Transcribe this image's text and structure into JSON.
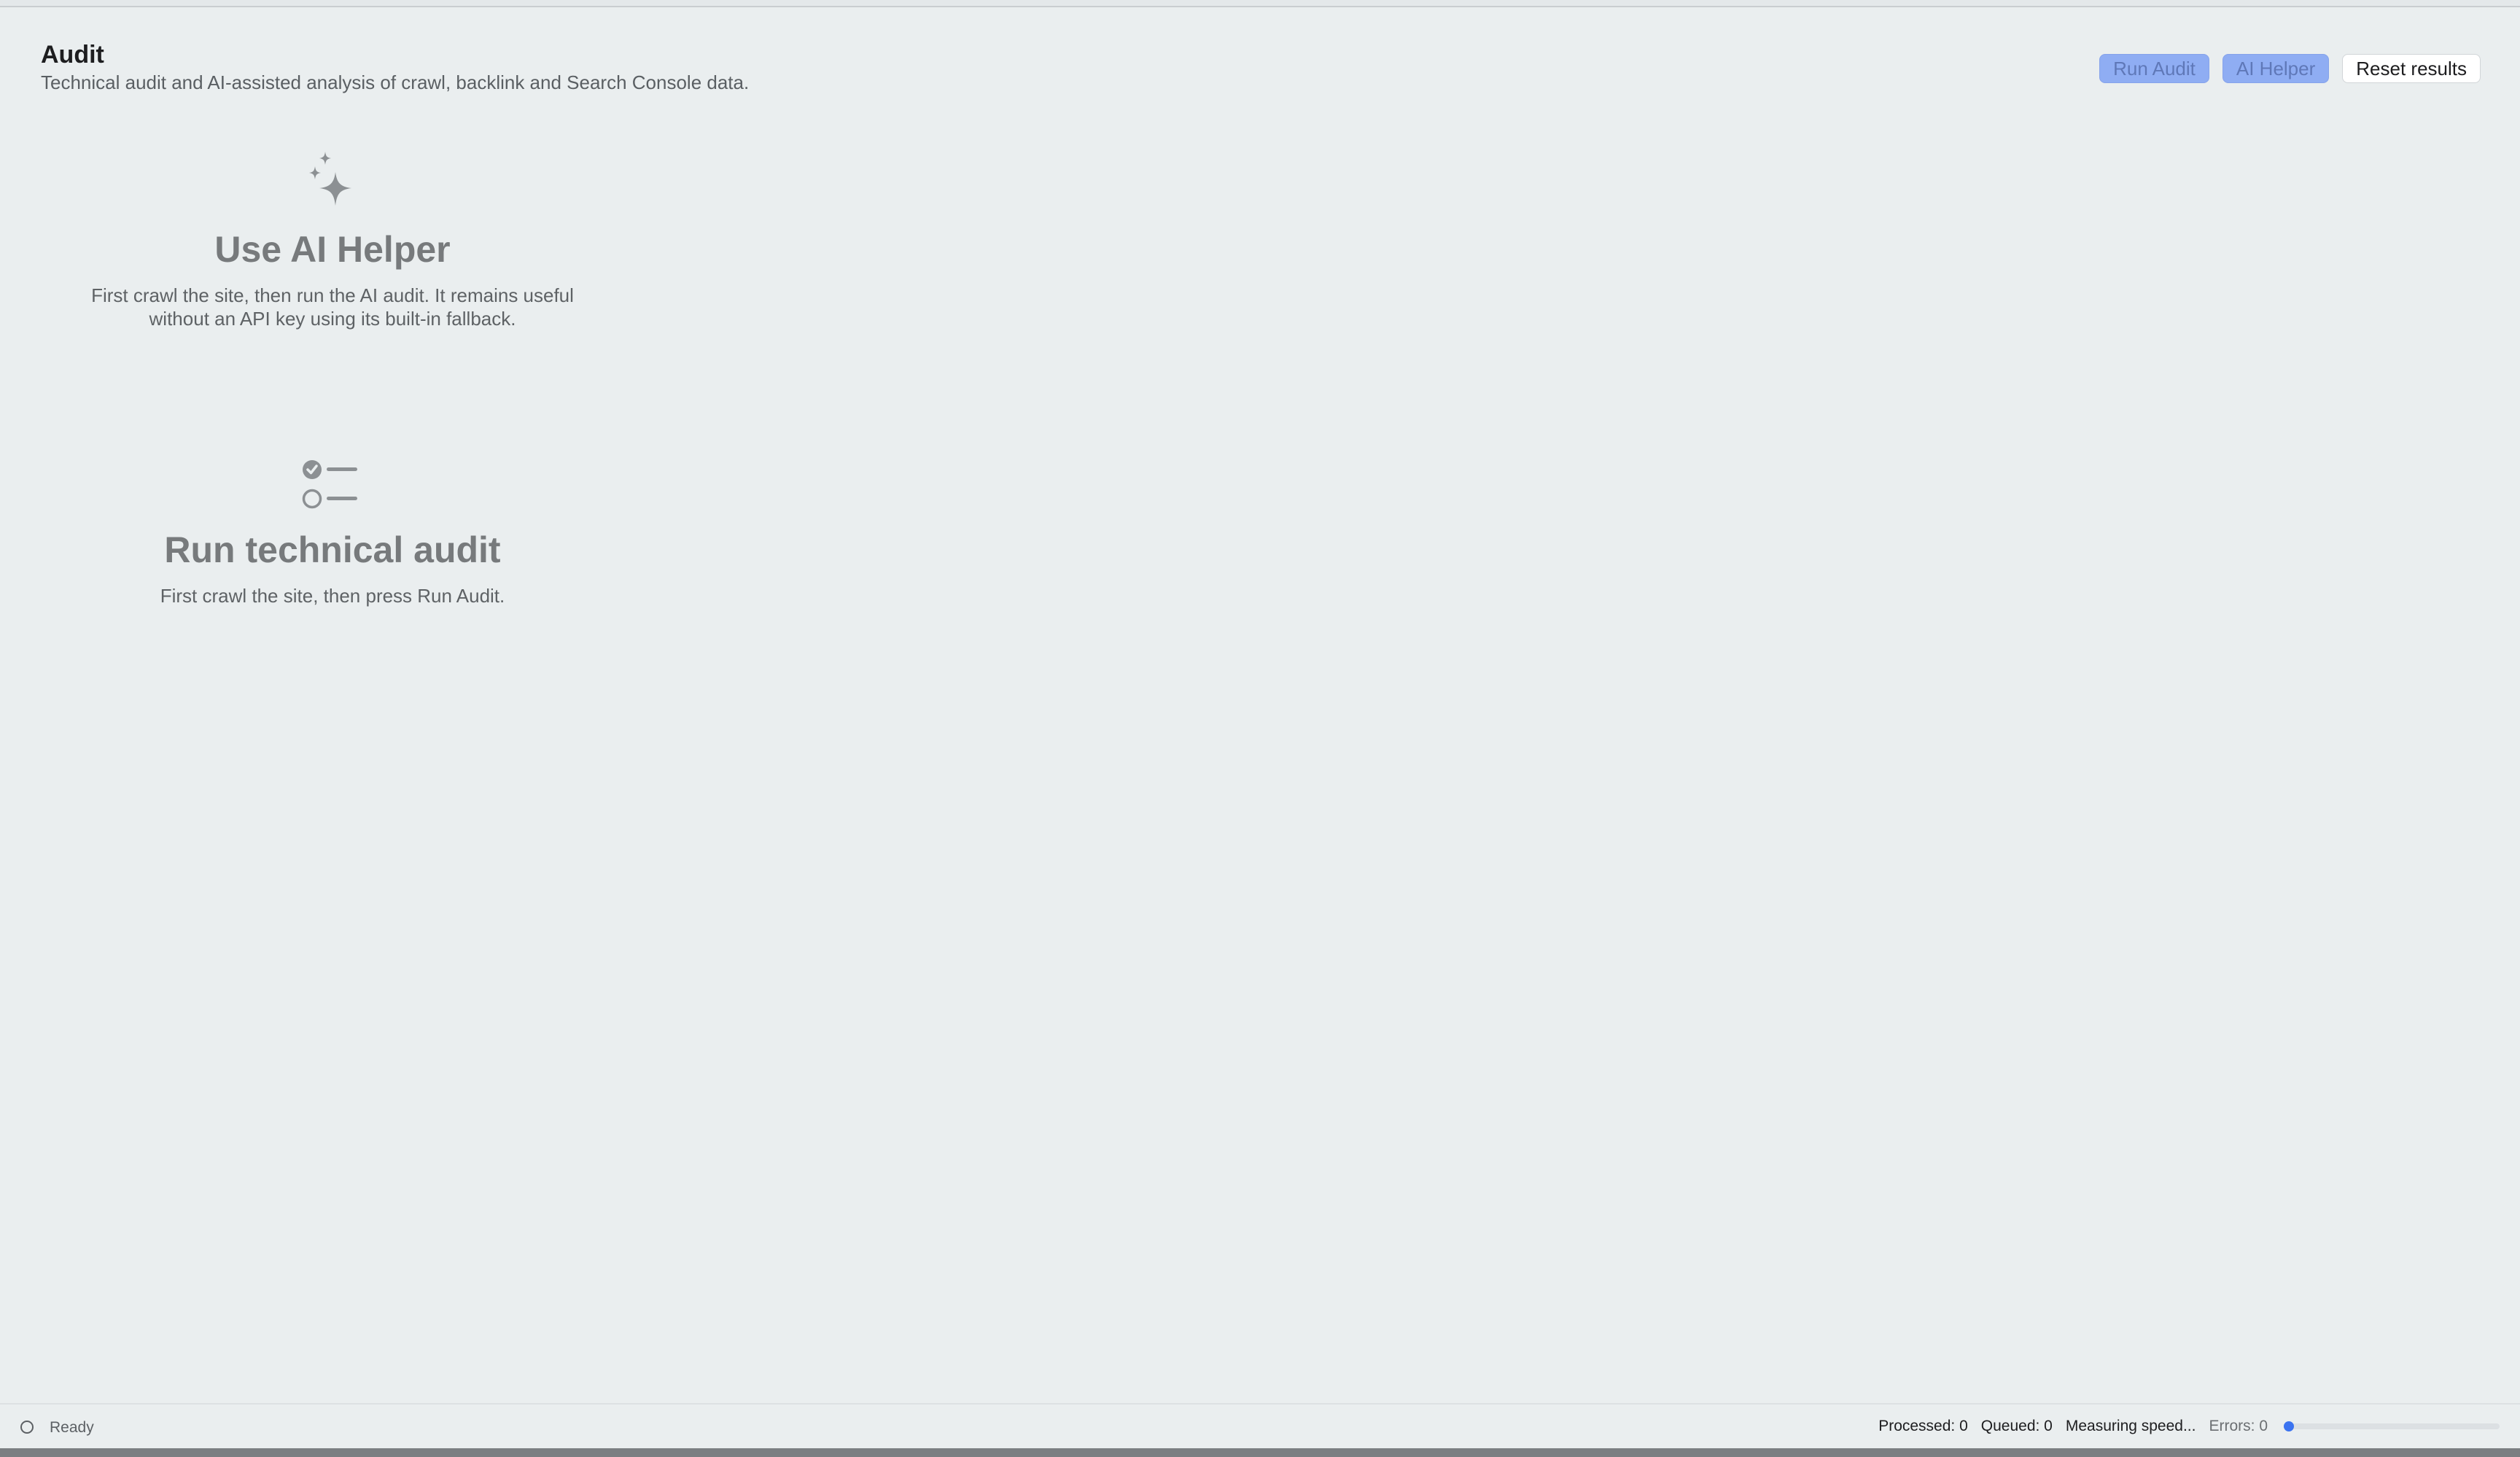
{
  "header": {
    "title": "Audit",
    "subtitle": "Technical audit and AI-assisted analysis of crawl, backlink and Search Console data."
  },
  "toolbar": {
    "run_audit_label": "Run Audit",
    "ai_helper_label": "AI Helper",
    "reset_label": "Reset results"
  },
  "ai_helper_panel": {
    "icon": "sparkles-icon",
    "heading": "Use AI Helper",
    "description": "First crawl the site, then run the AI audit. It remains useful without an API key using its built-in fallback."
  },
  "technical_audit_panel": {
    "icon": "checklist-icon",
    "heading": "Run technical audit",
    "description": "First crawl the site, then press Run Audit."
  },
  "status_bar": {
    "status_text": "Ready",
    "processed": "Processed: 0",
    "queued": "Queued: 0",
    "speed": "Measuring speed...",
    "errors": "Errors: 0",
    "progress_fraction": 0
  },
  "colors": {
    "accent": "#3b73f0",
    "primary_button_bg": "#8fadf3",
    "background": "#eaeeef"
  }
}
